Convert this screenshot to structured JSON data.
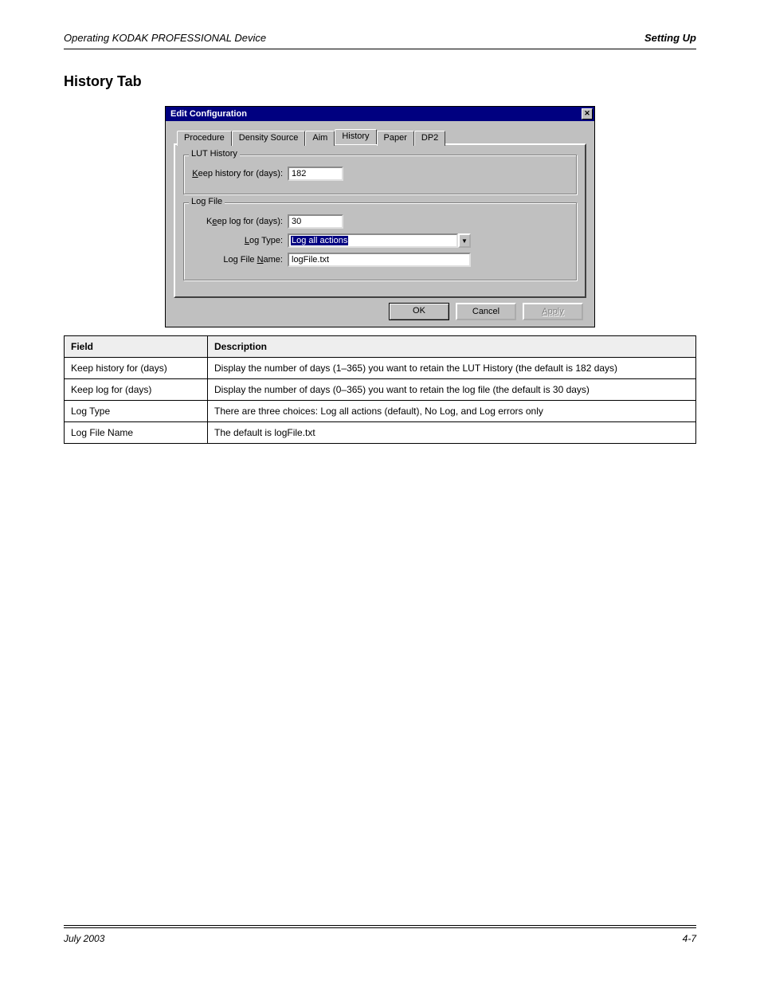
{
  "header": {
    "left": "Operating KODAK PROFESSIONAL Device",
    "right": "Setting Up"
  },
  "section_title": "History Tab",
  "dialog": {
    "title": "Edit Configuration",
    "tabs": [
      "Procedure",
      "Density Source",
      "Aim",
      "History",
      "Paper",
      "DP2"
    ],
    "active_tab": 3,
    "group1": {
      "legend": "LUT History",
      "fields": {
        "keep_history_label": "Keep history for (days):",
        "keep_history_value": "182",
        "keep_history_accel": "K"
      }
    },
    "group2": {
      "legend": "Log File",
      "fields": {
        "keep_log_label": "Keep log for (days):",
        "keep_log_value": "30",
        "keep_log_accel": "e",
        "log_type_label": "Log Type:",
        "log_type_value": "Log all actions",
        "log_type_accel": "L",
        "log_file_name_label": "Log File Name:",
        "log_file_name_value": "logFile.txt",
        "log_file_name_accel": "N"
      }
    },
    "buttons": {
      "ok": "OK",
      "cancel": "Cancel",
      "apply": "Apply"
    }
  },
  "table": {
    "head": [
      "Field",
      "Description"
    ],
    "rows": [
      [
        "Keep history for (days)",
        "Display the number of days (1–365) you want to retain the LUT History (the default is 182 days)"
      ],
      [
        "Keep log for (days)",
        "Display the number of days (0–365) you want to retain the log file (the default is 30 days)"
      ],
      [
        "Log Type",
        "There are three choices: Log all actions (default), No Log, and Log errors only"
      ],
      [
        "Log File Name",
        "The default is logFile.txt"
      ]
    ]
  },
  "footer": {
    "left": "July 2003",
    "right": "4-7"
  }
}
